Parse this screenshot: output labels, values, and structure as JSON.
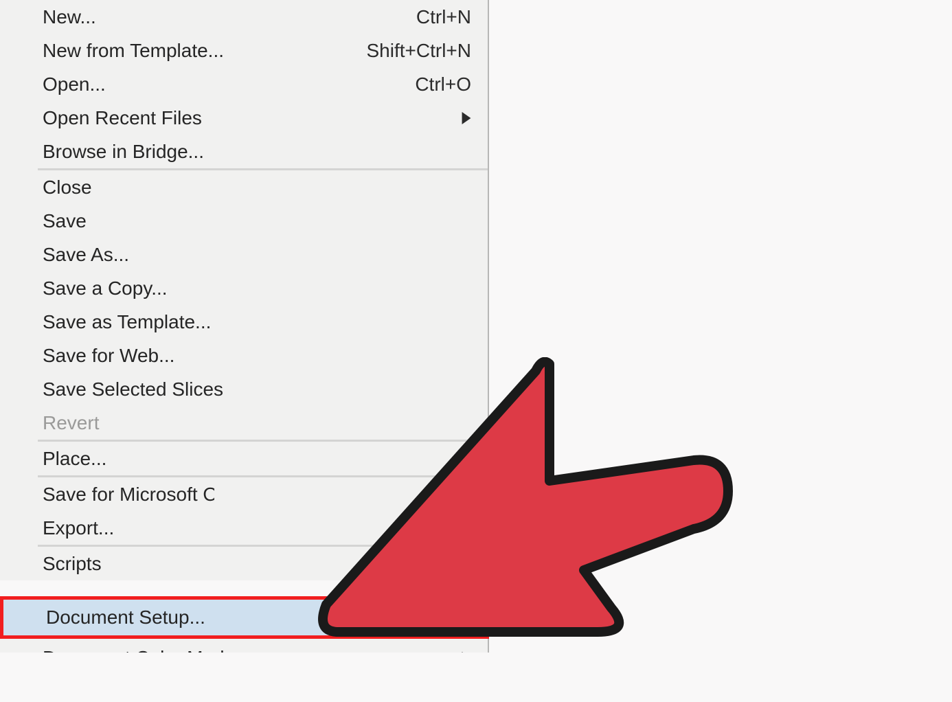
{
  "menu": {
    "items": [
      {
        "label": "New...",
        "shortcut": "Ctrl+N",
        "submenu": false,
        "disabled": false
      },
      {
        "label": "New from Template...",
        "shortcut": "Shift+Ctrl+N",
        "submenu": false,
        "disabled": false
      },
      {
        "label": "Open...",
        "shortcut": "Ctrl+O",
        "submenu": false,
        "disabled": false
      },
      {
        "label": "Open Recent Files",
        "shortcut": "",
        "submenu": true,
        "disabled": false
      },
      {
        "label": "Browse in Bridge...",
        "shortcut": "",
        "submenu": false,
        "disabled": false
      },
      {
        "sep": true
      },
      {
        "label": "Close",
        "shortcut": "",
        "submenu": false,
        "disabled": false
      },
      {
        "label": "Save",
        "shortcut": "",
        "submenu": false,
        "disabled": false
      },
      {
        "label": "Save As...",
        "shortcut": "",
        "submenu": false,
        "disabled": false
      },
      {
        "label": "Save a Copy...",
        "shortcut": "",
        "submenu": false,
        "disabled": false
      },
      {
        "label": "Save as Template...",
        "shortcut": "",
        "submenu": false,
        "disabled": false
      },
      {
        "label": "Save for Web...",
        "shortcut": "",
        "submenu": false,
        "disabled": false
      },
      {
        "label": "Save Selected Slices",
        "shortcut": "",
        "submenu": false,
        "disabled": false
      },
      {
        "label": "Revert",
        "shortcut": "",
        "submenu": false,
        "disabled": true
      },
      {
        "sep": true
      },
      {
        "label": "Place...",
        "shortcut": "",
        "submenu": false,
        "disabled": false
      },
      {
        "sep": true
      },
      {
        "label": "Save for Microsoft O",
        "shortcut": "",
        "submenu": false,
        "disabled": false,
        "truncated": true
      },
      {
        "label": "Export...",
        "shortcut": "",
        "submenu": false,
        "disabled": false
      },
      {
        "sep": true
      },
      {
        "label": "Scripts",
        "shortcut": "",
        "submenu": false,
        "disabled": false
      }
    ],
    "highlighted": {
      "label": "Document Setup..."
    },
    "partial": {
      "label": "Document Color Mode"
    }
  }
}
